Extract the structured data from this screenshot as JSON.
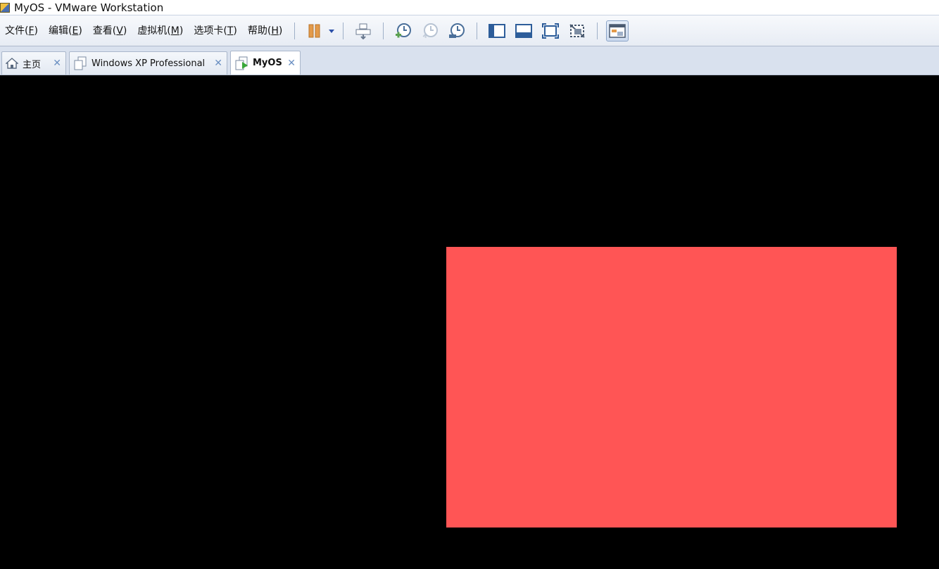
{
  "window": {
    "title": "MyOS - VMware Workstation"
  },
  "menu": [
    {
      "label": "文件(",
      "key": "F",
      "suffix": ")"
    },
    {
      "label": "编辑(",
      "key": "E",
      "suffix": ")"
    },
    {
      "label": "查看(",
      "key": "V",
      "suffix": ")"
    },
    {
      "label": "虚拟机(",
      "key": "M",
      "suffix": ")"
    },
    {
      "label": "选项卡(",
      "key": "T",
      "suffix": ")"
    },
    {
      "label": "帮助(",
      "key": "H",
      "suffix": ")"
    }
  ],
  "toolbar": {
    "icons": [
      "pause-icon",
      "dropdown-arrow-icon",
      "send-ctrl-alt-del-icon",
      "take-snapshot-icon",
      "revert-snapshot-icon",
      "snapshot-manager-icon",
      "show-library-icon",
      "show-thumbnail-bar-icon",
      "full-screen-icon",
      "unity-icon",
      "console-view-icon"
    ]
  },
  "tabs": [
    {
      "label": "主页",
      "icon": "home-icon",
      "active": false
    },
    {
      "label": "Windows XP Professional",
      "icon": "vm-icon",
      "active": false
    },
    {
      "label": "MyOS",
      "icon": "vm-running-icon",
      "active": true
    }
  ],
  "guest": {
    "background_color": "#000000",
    "rect_color": "#ff5555"
  }
}
